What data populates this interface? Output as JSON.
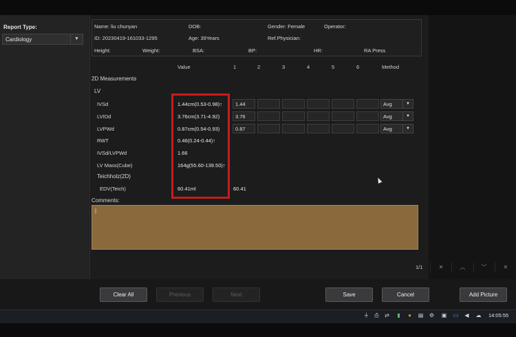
{
  "left_panel": {
    "report_type_label": "Report Type:",
    "report_type_value": "Cardiology"
  },
  "patient": {
    "name": "Name: liu chunyan",
    "dob": "DOB:",
    "gender": "Gender: Female",
    "operator": "Operator:",
    "id": "ID: 20230419-161033-1295",
    "age": "Age: 39Years",
    "ref_physician": "Ref.Physician:",
    "height": "Height:",
    "weight": "Weight:",
    "bsa": "BSA:",
    "bp": "BP:",
    "hr": "HR:",
    "ra_press": "RA Press"
  },
  "table_headers": {
    "value": "Value",
    "c1": "1",
    "c2": "2",
    "c3": "3",
    "c4": "4",
    "c5": "5",
    "c6": "6",
    "method": "Method"
  },
  "sections": {
    "measurements": "2D Measurements",
    "lv": "LV",
    "teichholz": "Teichholz(2D)"
  },
  "rows": [
    {
      "label": "IVSd",
      "value": "1.44cm(0.53-0.98)↑",
      "m1": "1.44",
      "method": "Avg"
    },
    {
      "label": "LVIDd",
      "value": "3.76cm(3.71-4.92)",
      "m1": "3.76",
      "method": "Avg"
    },
    {
      "label": "LVPWd",
      "value": "0.87cm(0.54-0.93)",
      "m1": "0.87",
      "method": "Avg"
    },
    {
      "label": "RWT",
      "value": "0.46(0.24-0.44)↑"
    },
    {
      "label": "IVSd/LVPWd",
      "value": "1.66"
    },
    {
      "label": "LV Mass(Cube)",
      "value": "164g(55.60-139.50)↑"
    },
    {
      "label": "EDV(Teich)",
      "value": "60.41ml",
      "m1": "60.41"
    }
  ],
  "comments": {
    "label": "Comments:",
    "text": "|"
  },
  "pagination": "1/1",
  "buttons": {
    "clear_all": "Clear All",
    "previous": "Previous",
    "next": "Next",
    "save": "Save",
    "cancel": "Cancel",
    "add_picture": "Add Picture"
  },
  "taskbar": {
    "clock": "14:05:55"
  }
}
